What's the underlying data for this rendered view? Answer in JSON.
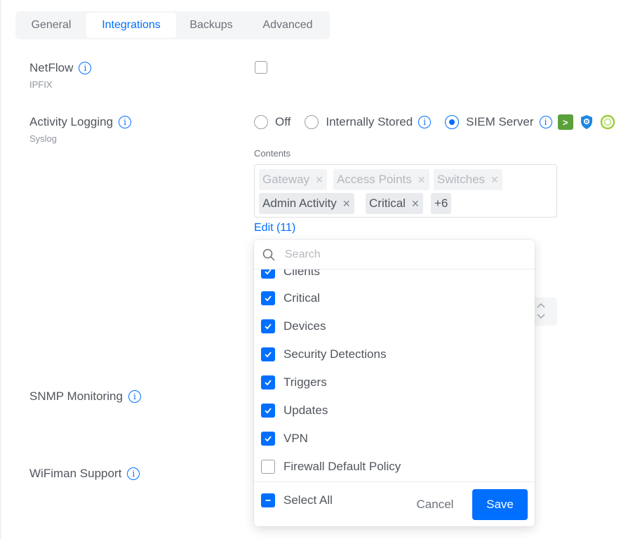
{
  "tabs": [
    {
      "label": "General"
    },
    {
      "label": "Integrations",
      "active": true
    },
    {
      "label": "Backups"
    },
    {
      "label": "Advanced"
    }
  ],
  "netflow": {
    "label": "NetFlow",
    "sub": "IPFIX",
    "enabled": false
  },
  "activity_logging": {
    "label": "Activity Logging",
    "sub": "Syslog",
    "options": [
      {
        "label": "Off",
        "selected": false
      },
      {
        "label": "Internally Stored",
        "selected": false
      },
      {
        "label": "SIEM Server",
        "selected": true
      }
    ],
    "brand_icons": [
      "splunk-icon",
      "shield-brand-icon",
      "qradar-icon"
    ],
    "contents_label": "Contents",
    "chips": [
      {
        "label": "Gateway",
        "disabled": true
      },
      {
        "label": "Access Points",
        "disabled": true
      },
      {
        "label": "Switches",
        "disabled": true
      },
      {
        "label": "Admin Activity",
        "disabled": false
      },
      {
        "label": "Critical",
        "disabled": false
      }
    ],
    "more_count": "+6",
    "edit_link": "Edit (11)"
  },
  "snmp": {
    "label": "SNMP Monitoring"
  },
  "wifiman": {
    "label": "WiFiman Support"
  },
  "dropdown": {
    "search_placeholder": "Search",
    "items": [
      {
        "label": "Clients",
        "checked": true
      },
      {
        "label": "Critical",
        "checked": true
      },
      {
        "label": "Devices",
        "checked": true
      },
      {
        "label": "Security Detections",
        "checked": true
      },
      {
        "label": "Triggers",
        "checked": true
      },
      {
        "label": "Updates",
        "checked": true
      },
      {
        "label": "VPN",
        "checked": true
      },
      {
        "label": "Firewall Default Policy",
        "checked": false
      }
    ],
    "select_all_label": "Select All",
    "select_all_state": "indeterminate",
    "cancel_label": "Cancel",
    "save_label": "Save"
  },
  "colors": {
    "accent": "#006fff",
    "text": "#50565e",
    "muted": "#8f949b"
  }
}
